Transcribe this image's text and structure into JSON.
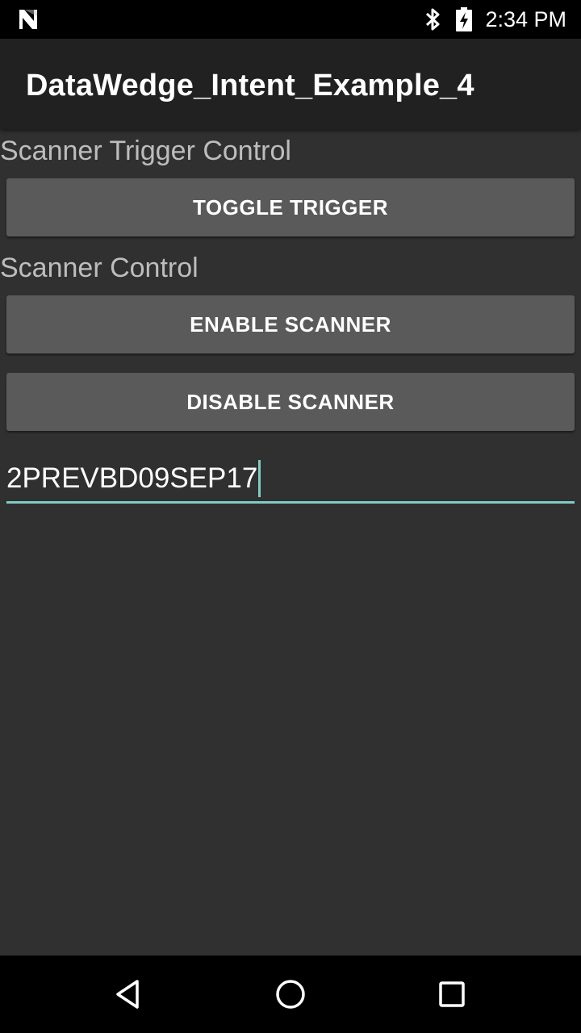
{
  "status_bar": {
    "time": "2:34 PM",
    "icons": [
      "notification-n-icon",
      "bluetooth-icon",
      "battery-charging-icon"
    ]
  },
  "app_bar": {
    "title": "DataWedge_Intent_Example_4"
  },
  "sections": {
    "trigger_label": "Scanner Trigger Control",
    "toggle_trigger_button": "TOGGLE TRIGGER",
    "scanner_label": "Scanner Control",
    "enable_scanner_button": "ENABLE SCANNER",
    "disable_scanner_button": "DISABLE SCANNER"
  },
  "scan_field": {
    "value": "2PREVBD09SEP17"
  },
  "nav_bar": {
    "icons": [
      "back-icon",
      "home-icon",
      "recents-icon"
    ]
  },
  "colors": {
    "background": "#303030",
    "app_bar": "#212121",
    "button": "#5a5a5a",
    "accent": "#80cbc4",
    "label_text": "#bdbdbd"
  }
}
